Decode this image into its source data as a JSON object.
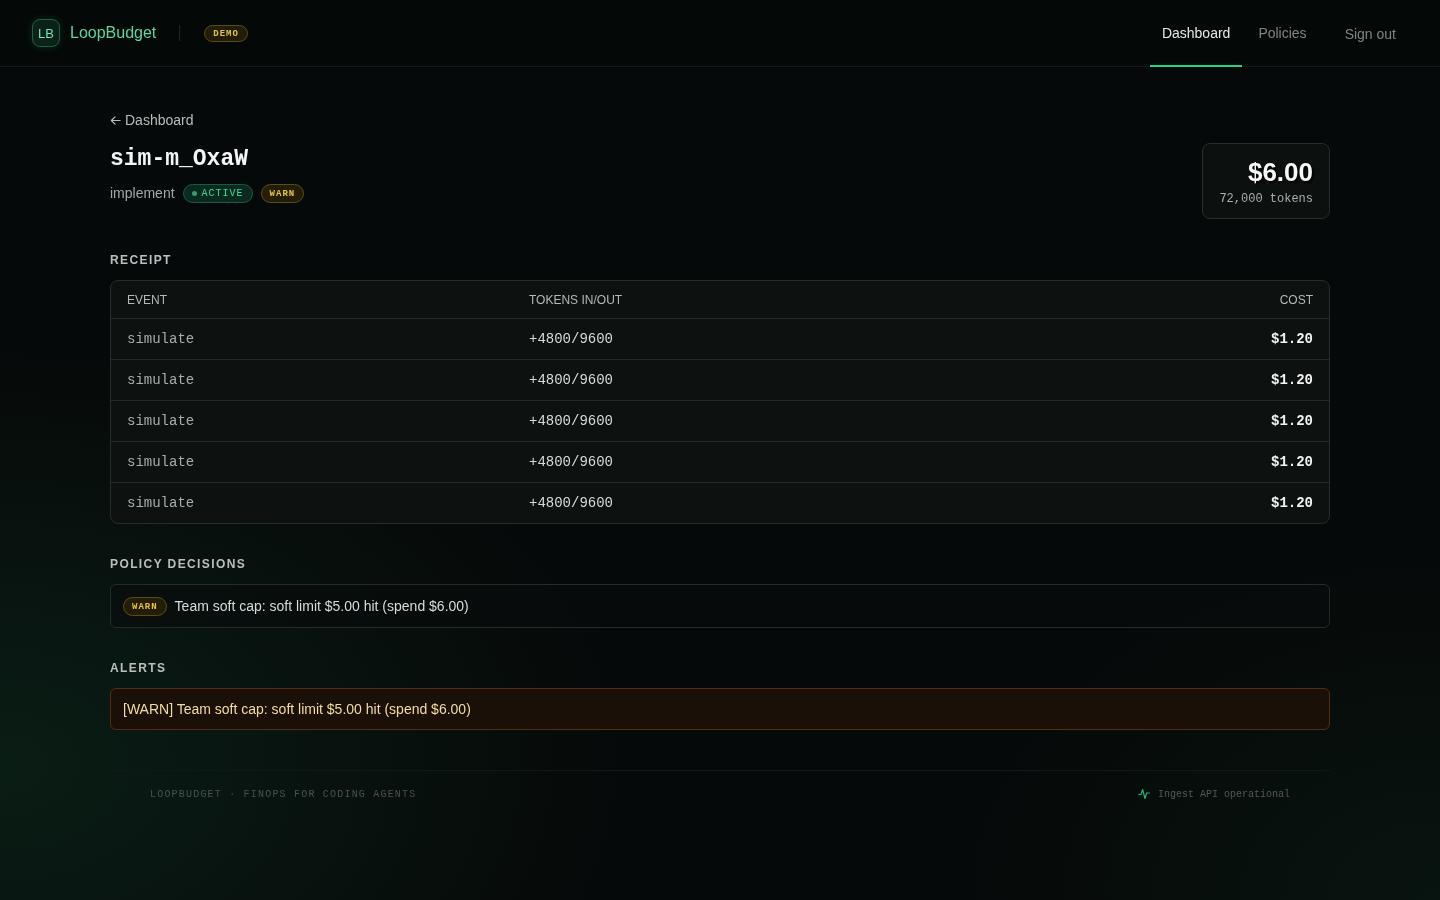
{
  "header": {
    "logo_mark": "LB",
    "brand": "LoopBudget",
    "badge": "DEMO",
    "nav": [
      {
        "label": "Dashboard",
        "selected": true
      },
      {
        "label": "Policies",
        "selected": false
      }
    ],
    "sign_out": "Sign out"
  },
  "back_link": "Dashboard",
  "run": {
    "title": "sim-m_OxaW",
    "task": "implement",
    "badges": [
      {
        "kind": "status",
        "label": "ACTIVE"
      },
      {
        "kind": "warn",
        "label": "WARN"
      }
    ]
  },
  "total": {
    "cost": "$6.00",
    "tokens": "72,000 tokens"
  },
  "receipt": {
    "title": "RECEIPT",
    "columns": [
      "EVENT",
      "TOKENS IN/OUT",
      "COST"
    ],
    "rows": [
      [
        "simulate",
        "+4800/9600",
        "$1.20"
      ],
      [
        "simulate",
        "+4800/9600",
        "$1.20"
      ],
      [
        "simulate",
        "+4800/9600",
        "$1.20"
      ],
      [
        "simulate",
        "+4800/9600",
        "$1.20"
      ],
      [
        "simulate",
        "+4800/9600",
        "$1.20"
      ]
    ]
  },
  "policy_decisions": {
    "title": "POLICY DECISIONS",
    "items": [
      {
        "badge": "WARN",
        "text": "Team soft cap: soft limit $5.00 hit (spend $6.00)"
      }
    ]
  },
  "alerts": {
    "title": "ALERTS",
    "items": [
      {
        "text": "[WARN] Team soft cap: soft limit $5.00 hit (spend $6.00)"
      }
    ]
  },
  "footer": {
    "tagline": "LOOPBUDGET · FINOPS FOR CODING AGENTS",
    "status": "Ingest API operational"
  }
}
